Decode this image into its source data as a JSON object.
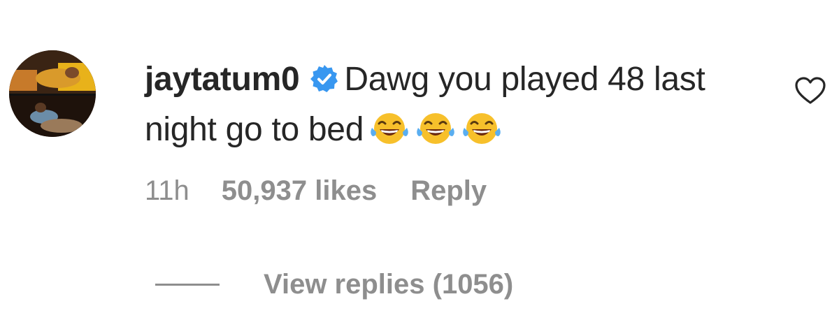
{
  "comment": {
    "username": "jaytatum0",
    "verified": true,
    "text": "Dawg you played 48 last night go to bed",
    "emojis": [
      "face-with-tears-of-joy-icon",
      "face-with-tears-of-joy-icon",
      "face-with-tears-of-joy-icon"
    ],
    "time": "11h",
    "likes": "50,937 likes",
    "reply_label": "Reply",
    "view_replies": "View replies (1056)"
  },
  "colors": {
    "text": "#262626",
    "meta": "#8e8e8e",
    "verified_blue": "#3897f0",
    "emoji_yellow": "#f7c02b",
    "emoji_tears": "#5aaef0"
  }
}
